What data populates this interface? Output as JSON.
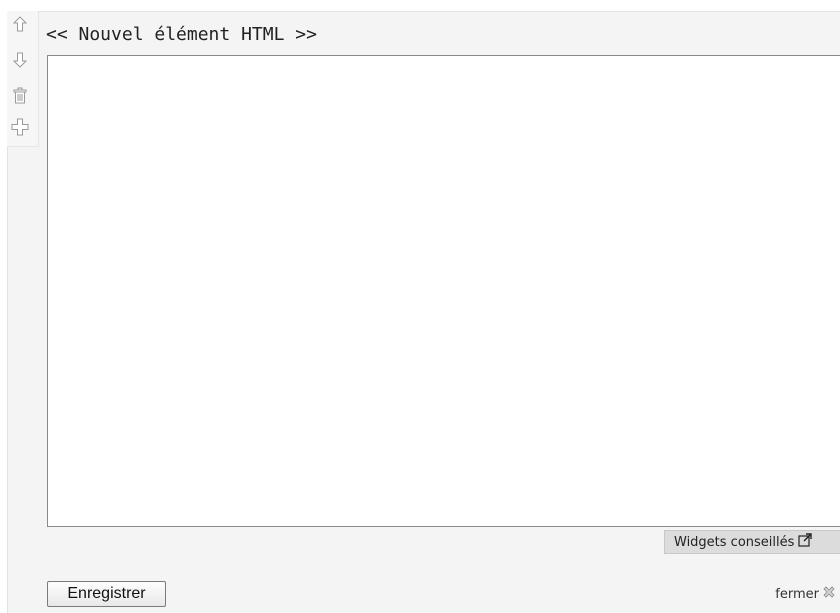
{
  "widget": {
    "title": "<< Nouvel élément HTML >>",
    "editor_value": ""
  },
  "toolbar": {
    "icons": [
      "arrow-up-icon",
      "arrow-down-icon",
      "trash-icon",
      "plus-icon"
    ]
  },
  "footer": {
    "widgets_label": "Widgets conseillés",
    "save_label": "Enregistrer",
    "close_label": "fermer"
  },
  "colors": {
    "panel_bg": "#f4f4f4",
    "editor_border": "#8a8a8a",
    "button_bg": "#dcdcdc",
    "icon_gray": "#9a9a9a"
  }
}
